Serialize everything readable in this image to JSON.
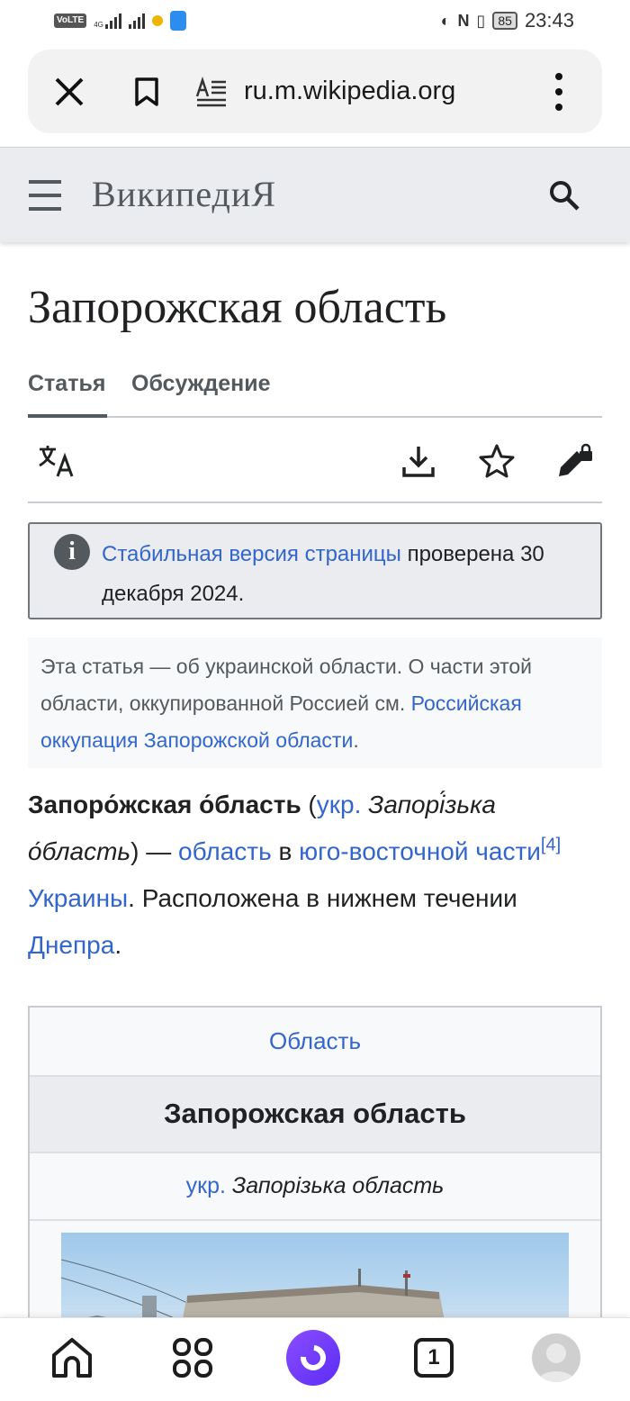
{
  "status_bar": {
    "volte": "VoLTE",
    "network_4g": "4G",
    "battery": "85",
    "time": "23:43"
  },
  "browser": {
    "url": "ru.m.wikipedia.org"
  },
  "wiki": {
    "wordmark": "ВикипедиЯ"
  },
  "article": {
    "title": "Запорожская область",
    "tabs": [
      {
        "label": "Статья"
      },
      {
        "label": "Обсуждение"
      }
    ],
    "notice": {
      "link": "Стабильная версия страницы",
      "text": " проверена 30 декабря 2024."
    },
    "hatnote": {
      "text": "Эта статья — об украинской области. О части этой области, оккупированной Россией см. ",
      "link": "Российская оккупация Запорожской области",
      "end": "."
    },
    "lead": {
      "bold_name": "Запоро́жская о́бласть",
      "open_paren": " (",
      "ukr_link": "укр.",
      "ukr_name": " Запорі́зька о́бласть",
      "close_paren": ") — ",
      "link_oblast": "область",
      "word_in": " в ",
      "link_part": "юго-восточной части",
      "ref": "[4]",
      "space": " ",
      "link_ukraine": "Украины",
      "text_located": ". Расположена в нижнем течении ",
      "link_dnepr": "Днепра",
      "end": "."
    },
    "infobox": {
      "type_link": "Область",
      "name": "Запорожская область",
      "native_link": "укр.",
      "native_name": " Запорізька область"
    }
  },
  "bottom_nav": {
    "tabs_count": "1"
  }
}
